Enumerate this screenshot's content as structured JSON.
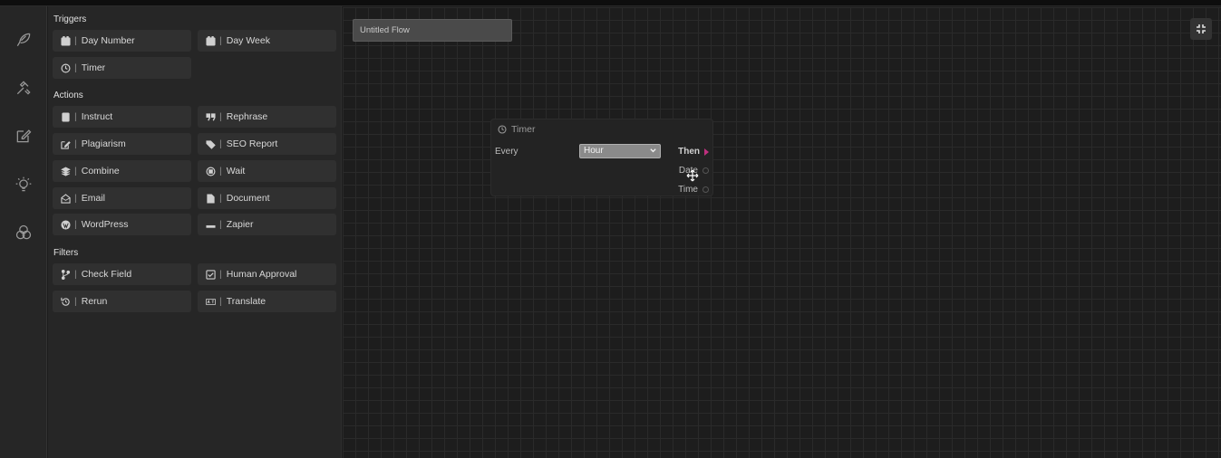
{
  "sidebar_icons": [
    "feather-icon",
    "tools-icon",
    "edit-icon",
    "bulb-icon",
    "venn-icon"
  ],
  "panel": {
    "sections": [
      {
        "title": "Triggers",
        "items": [
          {
            "label": "Day Number",
            "icon": "calendar-icon"
          },
          {
            "label": "Day Week",
            "icon": "calendar-icon"
          },
          {
            "label": "Timer",
            "icon": "clock-icon"
          }
        ]
      },
      {
        "title": "Actions",
        "items": [
          {
            "label": "Instruct",
            "icon": "scroll-icon"
          },
          {
            "label": "Rephrase",
            "icon": "quote-icon"
          },
          {
            "label": "Plagiarism",
            "icon": "edit-icon"
          },
          {
            "label": "SEO Report",
            "icon": "tags-icon"
          },
          {
            "label": "Combine",
            "icon": "layers-icon"
          },
          {
            "label": "Wait",
            "icon": "stop-circle-icon"
          },
          {
            "label": "Email",
            "icon": "envelope-open-icon"
          },
          {
            "label": "Document",
            "icon": "file-icon"
          },
          {
            "label": "WordPress",
            "icon": "wordpress-icon"
          },
          {
            "label": "Zapier",
            "icon": "minus-icon"
          }
        ]
      },
      {
        "title": "Filters",
        "items": [
          {
            "label": "Check Field",
            "icon": "branch-icon"
          },
          {
            "label": "Human Approval",
            "icon": "checkbox-icon"
          },
          {
            "label": "Rerun",
            "icon": "history-icon"
          },
          {
            "label": "Translate",
            "icon": "language-icon"
          }
        ]
      }
    ]
  },
  "canvas": {
    "flow_title": "Untitled Flow",
    "node": {
      "title": "Timer",
      "every_label": "Every",
      "every_value": "Hour",
      "outputs": [
        "Then",
        "Date",
        "Time"
      ]
    }
  },
  "colors": {
    "accent_port": "#c0307f"
  }
}
